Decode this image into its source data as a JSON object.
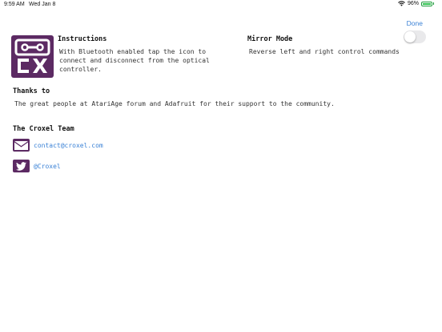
{
  "status_bar": {
    "time": "9:59 AM",
    "date": "Wed Jan 8",
    "battery": "96%",
    "battery_level": 0.96
  },
  "nav": {
    "done_label": "Done"
  },
  "instructions": {
    "title": "Instructions",
    "lines": [
      "With Bluetooth enabled tap the icon to",
      "connect and disconnect from the optical",
      "controller."
    ]
  },
  "mirror_mode": {
    "title": "Mirror Mode",
    "description": "Reverse left and right control commands",
    "enabled": false
  },
  "thanks": {
    "title": "Thanks to",
    "text": "The great people at AtariAge forum and  Adafruit for their support to the community."
  },
  "team": {
    "title": "The Croxel Team",
    "email": "contact@croxel.com",
    "twitter": "@Croxel"
  },
  "colors": {
    "brand": "#5c2a63",
    "link": "#3b82d6"
  },
  "icons": {
    "logo": "cx-controller-logo",
    "email": "envelope-icon",
    "twitter": "twitter-bird-icon"
  }
}
